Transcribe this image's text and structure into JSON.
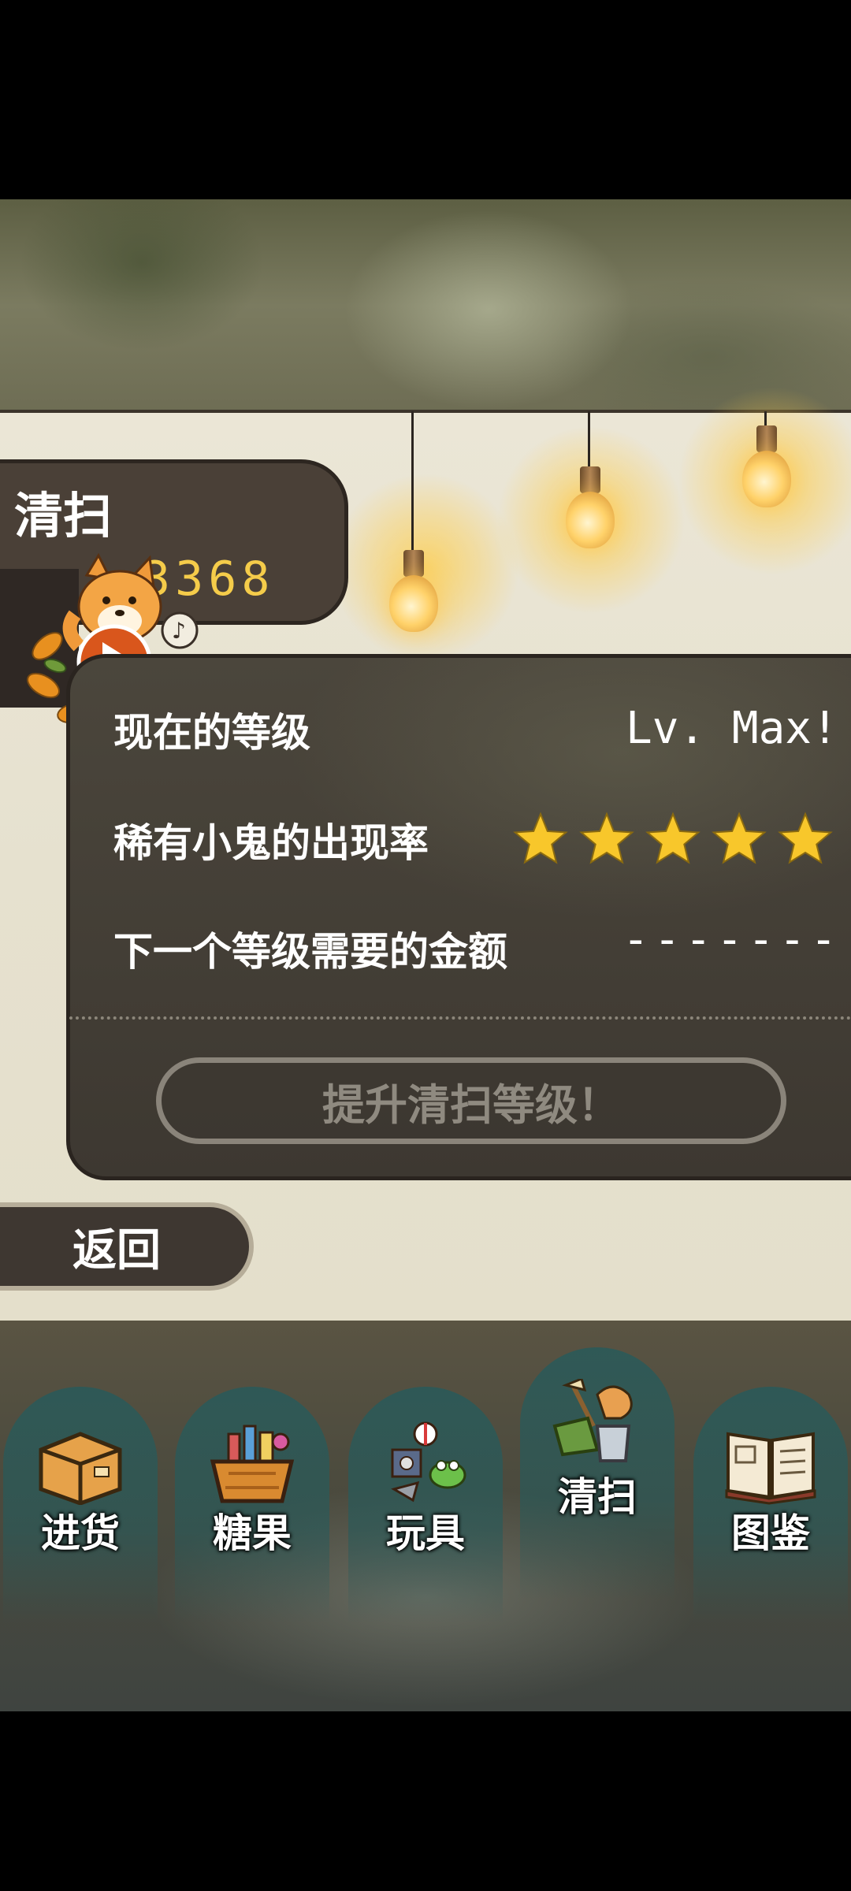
{
  "header": {
    "title": "清扫",
    "coins": "3368"
  },
  "level_panel": {
    "current_level_label": "现在的等级",
    "current_level_value": "Lv. Max!",
    "rare_rate_label": "稀有小鬼的出现率",
    "rare_rate_stars": 5,
    "next_cost_label": "下一个等级需要的金额",
    "next_cost_value": "-------",
    "upgrade_button": "提升清扫等级！"
  },
  "back_button": "返回",
  "nav": {
    "tabs": [
      {
        "label": "进货",
        "icon": "cardboard-box-icon"
      },
      {
        "label": "糖果",
        "icon": "candy-basket-icon"
      },
      {
        "label": "玩具",
        "icon": "toys-icon"
      },
      {
        "label": "清扫",
        "icon": "broom-duster-icon",
        "active": true
      },
      {
        "label": "图鉴",
        "icon": "open-book-icon"
      }
    ]
  },
  "colors": {
    "panel_bg": "#433e35",
    "coin_text": "#f5cc4a",
    "star": "#f8c72b",
    "tab_bg": "#2a5a5a"
  }
}
